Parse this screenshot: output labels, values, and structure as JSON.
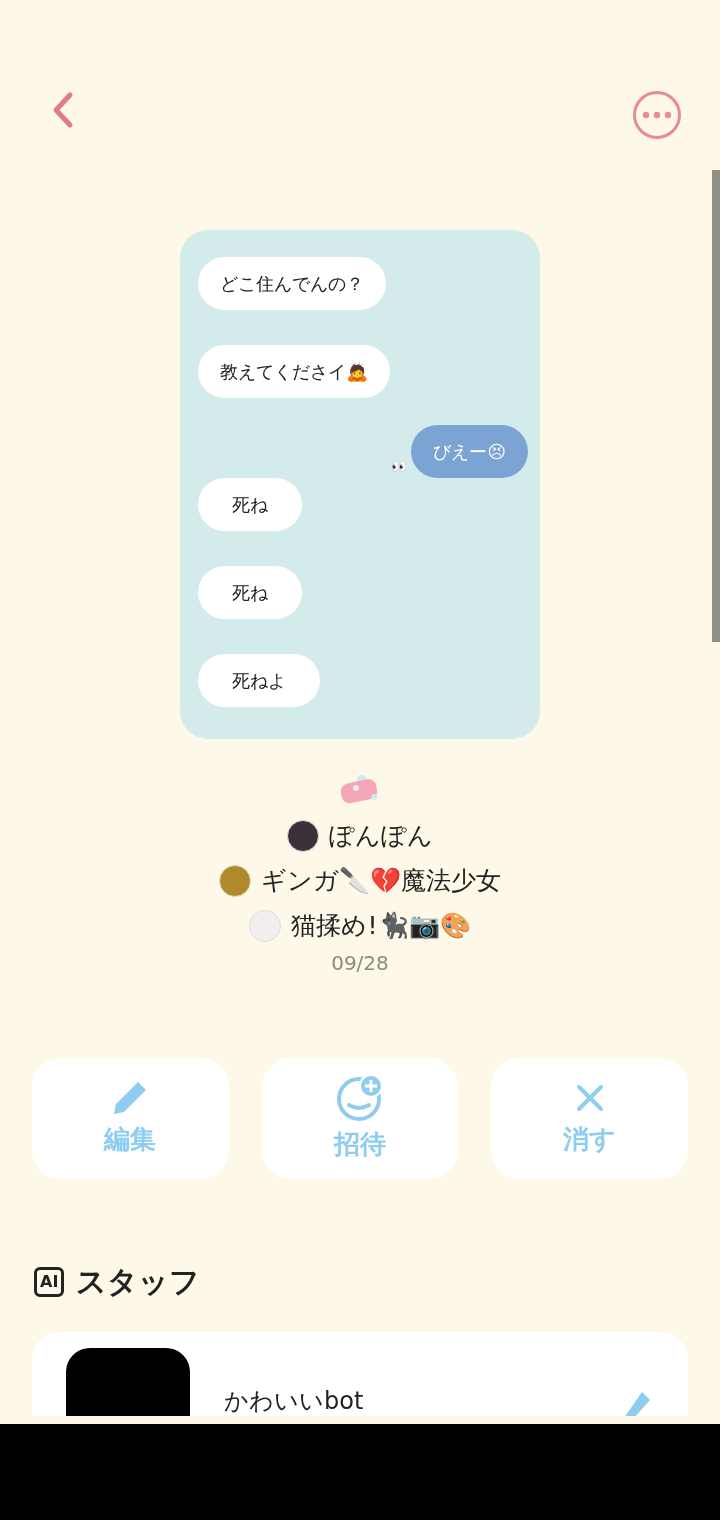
{
  "chat_preview": {
    "messages": [
      {
        "text": "どこ住んでんの？",
        "outgoing": false
      },
      {
        "text": "教えてくださイ🙇",
        "outgoing": false
      },
      {
        "text": "びえー😣",
        "outgoing": true,
        "reaction": "👀"
      },
      {
        "text": "死ね",
        "outgoing": false
      },
      {
        "text": "死ね",
        "outgoing": false
      },
      {
        "text": "死ねよ",
        "outgoing": false
      }
    ]
  },
  "members": [
    {
      "name": "ぽんぽん"
    },
    {
      "name": "ギンガ🔪💔魔法少女"
    },
    {
      "name": "猫揉め!🐈‍⬛📷🎨"
    }
  ],
  "date": "09/28",
  "actions": [
    {
      "label": "編集",
      "kind": "edit"
    },
    {
      "label": "招待",
      "kind": "invite"
    },
    {
      "label": "消す",
      "kind": "delete"
    }
  ],
  "staff": {
    "badge": "AI",
    "title": "スタッフ",
    "bots": [
      {
        "name": "かわいいbot"
      }
    ]
  }
}
